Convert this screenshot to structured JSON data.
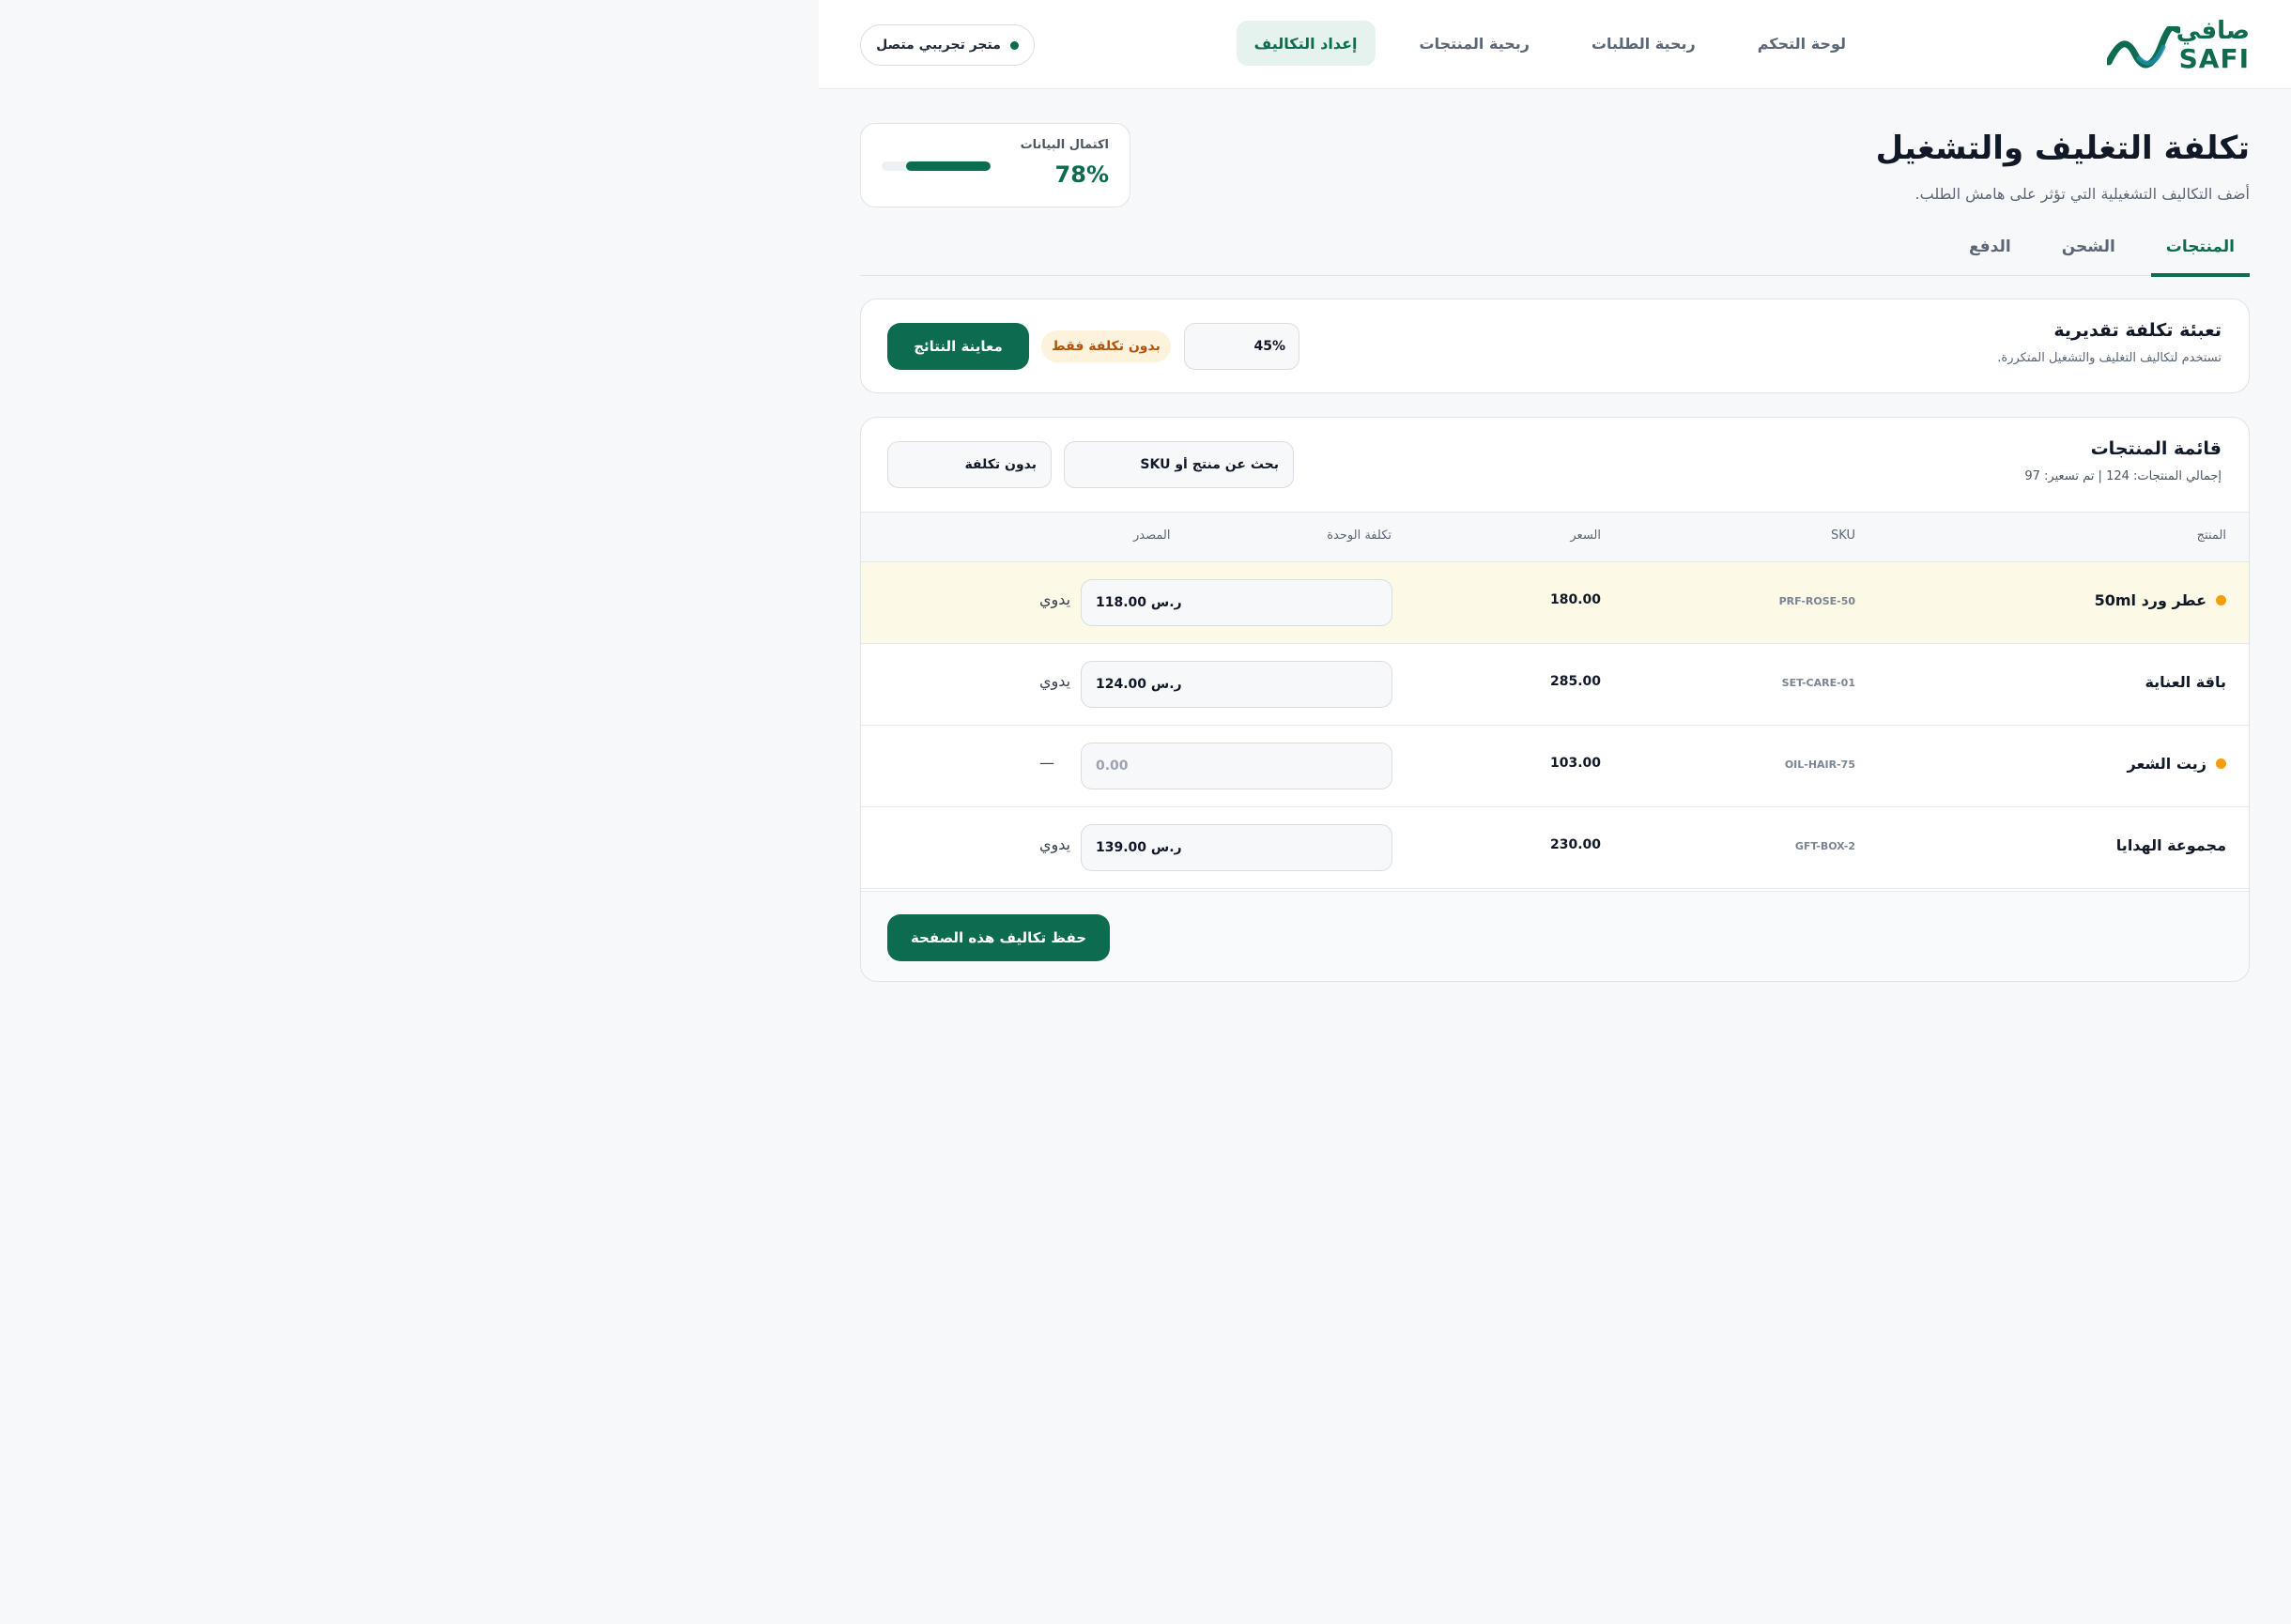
{
  "brand": {
    "name_ar": "صافي",
    "name_en": "SAFI"
  },
  "nav": {
    "items": [
      {
        "label": "لوحة التحكم",
        "active": false
      },
      {
        "label": "ربحية الطلبات",
        "active": false
      },
      {
        "label": "ربحية المنتجات",
        "active": false
      },
      {
        "label": "إعداد التكاليف",
        "active": true
      }
    ]
  },
  "store": {
    "status_label": "متجر تجريبي متصل"
  },
  "page": {
    "title": "تكلفة التغليف والتشغيل",
    "subtitle": "أضف التكاليف التشغيلية التي تؤثر على هامش الطلب."
  },
  "completion": {
    "label": "اكتمال البيانات",
    "value_text": "78%",
    "fraction": 0.78
  },
  "tabs": [
    {
      "label": "المنتجات",
      "active": true
    },
    {
      "label": "الشحن",
      "active": false
    },
    {
      "label": "الدفع",
      "active": false
    }
  ],
  "estimate": {
    "title": "تعبئة تكلفة تقديرية",
    "description": "تستخدم لتكاليف التغليف والتشغيل المتكررة.",
    "percent_value": "45%",
    "badge": "بدون تكلفة فقط",
    "preview_button": "معاينة النتائج"
  },
  "products": {
    "title": "قائمة المنتجات",
    "meta": "إجمالي المنتجات: 124 | تم تسعير: 97",
    "search_placeholder": "بحث عن منتج أو SKU",
    "filter_value": "بدون تكلفة",
    "columns": {
      "product": "المنتج",
      "sku": "SKU",
      "price": "السعر",
      "unit_cost": "تكلفة الوحدة",
      "source": "المصدر"
    },
    "rows": [
      {
        "name": "عطر ورد 50ml",
        "sku": "PRF-ROSE-50",
        "price": "180.00",
        "cost_value": "118.00 ر.س",
        "cost_placeholder": "",
        "source": "يدوي",
        "flag": true
      },
      {
        "name": "باقة العناية",
        "sku": "SET-CARE-01",
        "price": "285.00",
        "cost_value": "124.00 ر.س",
        "cost_placeholder": "",
        "source": "يدوي",
        "flag": false
      },
      {
        "name": "زيت الشعر",
        "sku": "OIL-HAIR-75",
        "price": "103.00",
        "cost_value": "",
        "cost_placeholder": "0.00",
        "source": "—",
        "flag": true
      },
      {
        "name": "مجموعة الهدايا",
        "sku": "GFT-BOX-2",
        "price": "230.00",
        "cost_value": "139.00 ر.س",
        "cost_placeholder": "",
        "source": "يدوي",
        "flag": false
      }
    ],
    "save_button": "حفظ تكاليف هذه الصفحة"
  },
  "colors": {
    "brand": "#0d6b4f",
    "warn": "#f59e0b",
    "highlight_row": "#fdf9e7"
  }
}
